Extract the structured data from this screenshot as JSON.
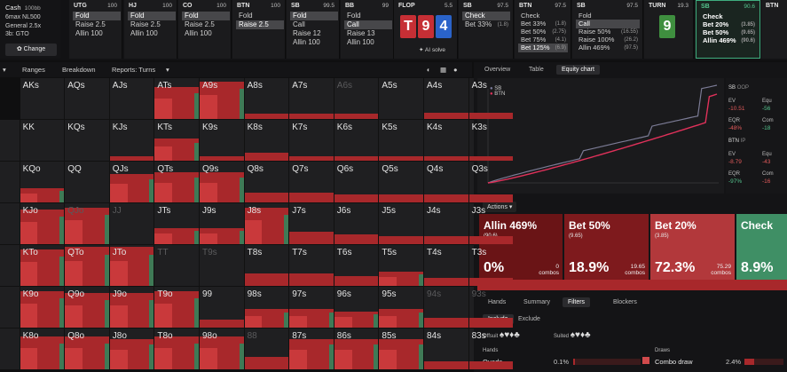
{
  "game": {
    "mode": "Cash",
    "stakes": "100bb",
    "lines": [
      "6max NL500",
      "General 2.5x",
      "3b: GTO"
    ],
    "change_label": "Change"
  },
  "positions": [
    {
      "name": "UTG",
      "stack": "100",
      "actions": [
        {
          "label": "Fold",
          "sel": true
        },
        {
          "label": "Raise 2.5",
          "sel": false
        },
        {
          "label": "Allin 100",
          "sel": false
        }
      ]
    },
    {
      "name": "HJ",
      "stack": "100",
      "actions": [
        {
          "label": "Fold",
          "sel": true
        },
        {
          "label": "Raise 2.5",
          "sel": false
        },
        {
          "label": "Allin 100",
          "sel": false
        }
      ]
    },
    {
      "name": "CO",
      "stack": "100",
      "actions": [
        {
          "label": "Fold",
          "sel": true
        },
        {
          "label": "Raise 2.5",
          "sel": false
        },
        {
          "label": "Allin 100",
          "sel": false
        }
      ]
    },
    {
      "name": "BTN",
      "stack": "100",
      "actions": [
        {
          "label": "Fold",
          "sel": false
        },
        {
          "label": "Raise 2.5",
          "sel": true
        }
      ]
    },
    {
      "name": "SB",
      "stack": "99.5",
      "actions": [
        {
          "label": "Fold",
          "sel": true
        },
        {
          "label": "Call",
          "sel": false
        },
        {
          "label": "Raise 12",
          "sel": false
        },
        {
          "label": "Allin 100",
          "sel": false
        }
      ]
    },
    {
      "name": "BB",
      "stack": "99",
      "actions": [
        {
          "label": "Fold",
          "sel": false
        },
        {
          "label": "Call",
          "sel": true
        },
        {
          "label": "Raise 13",
          "sel": false
        },
        {
          "label": "Allin 100",
          "sel": false
        }
      ]
    }
  ],
  "flop": {
    "label": "FLOP",
    "pot": "5.5",
    "cards": [
      {
        "rank": "T",
        "color": "#c62f35"
      },
      {
        "rank": "9",
        "color": "#c62f35"
      },
      {
        "rank": "4",
        "color": "#2a63c9"
      }
    ],
    "ai_label": "AI solve"
  },
  "sb_flop": {
    "name": "SB",
    "stack": "97.5",
    "actions": [
      {
        "label": "Check",
        "sel": true,
        "pct": ""
      },
      {
        "label": "Bet 33%",
        "sel": false,
        "pct": "(1.8)"
      }
    ]
  },
  "btn_flop": {
    "name": "BTN",
    "stack": "97.5",
    "actions": [
      {
        "label": "Check",
        "sel": false,
        "pct": ""
      },
      {
        "label": "Bet 33%",
        "sel": false,
        "pct": "(1.8)"
      },
      {
        "label": "Bet 50%",
        "sel": false,
        "pct": "(2.75)"
      },
      {
        "label": "Bet 75%",
        "sel": false,
        "pct": "(4.1)"
      },
      {
        "label": "Bet 125%",
        "sel": true,
        "pct": "(6.9)"
      }
    ]
  },
  "sb_flop2": {
    "name": "SB",
    "stack": "97.5",
    "actions": [
      {
        "label": "Fold",
        "sel": false,
        "pct": ""
      },
      {
        "label": "Call",
        "sel": true,
        "pct": ""
      },
      {
        "label": "Raise 50%",
        "sel": false,
        "pct": "(16.55)"
      },
      {
        "label": "Raise 100%",
        "sel": false,
        "pct": "(26.2)"
      },
      {
        "label": "Allin 469%",
        "sel": false,
        "pct": "(97.5)"
      }
    ]
  },
  "turn": {
    "label": "TURN",
    "pot": "19.3",
    "card": "9",
    "card_color": "#3f8f3f"
  },
  "sb_turn": {
    "name": "SB",
    "stack": "90.6",
    "actions": [
      {
        "label": "Check",
        "pct": ""
      },
      {
        "label": "Bet 20%",
        "pct": "(3.85)"
      },
      {
        "label": "Bet 50%",
        "pct": "(9.65)"
      },
      {
        "label": "Allin 469%",
        "pct": "(90.6)"
      }
    ]
  },
  "btn_turn": {
    "name": "BTN"
  },
  "toolbar": {
    "ranges": "Ranges",
    "breakdown": "Breakdown",
    "reports": "Reports: Turns"
  },
  "grid": [
    [
      "AKs",
      "AQs",
      "AJs",
      "ATs",
      "A9s",
      "A8s",
      "A7s",
      "A6s",
      "A5s",
      "A4s",
      "A3s",
      "A2s"
    ],
    [
      "",
      "KK",
      "KQs",
      "KJs",
      "KTs",
      "K9s",
      "K8s",
      "K7s",
      "K6s",
      "K5s",
      "K4s",
      "K3s",
      "K2s"
    ],
    [
      "",
      "KQo",
      "QQ",
      "QJs",
      "QTs",
      "Q9s",
      "Q8s",
      "Q7s",
      "Q6s",
      "Q5s",
      "Q4s",
      "Q3s",
      "Q2s"
    ],
    [
      "",
      "KJo",
      "QJo",
      "JJ",
      "JTs",
      "J9s",
      "J8s",
      "J7s",
      "J6s",
      "J5s",
      "J4s",
      "J3s",
      "J2s"
    ],
    [
      "",
      "KTo",
      "QTo",
      "JTo",
      "TT",
      "T9s",
      "T8s",
      "T7s",
      "T6s",
      "T5s",
      "T4s",
      "T3s",
      "T2s"
    ],
    [
      "",
      "K9o",
      "Q9o",
      "J9o",
      "T9o",
      "99",
      "98s",
      "97s",
      "96s",
      "95s",
      "94s",
      "93s",
      "92s"
    ],
    [
      "",
      "K8o",
      "Q8o",
      "J8o",
      "T8o",
      "98o",
      "88",
      "87s",
      "86s",
      "85s",
      "84s",
      "83s",
      "82s"
    ]
  ],
  "panel": {
    "tabs": [
      "Overview",
      "Table",
      "Equity chart"
    ],
    "legend": [
      {
        "name": "SB",
        "color": "#7a7a9a"
      },
      {
        "name": "BTN",
        "color": "#e0315a"
      }
    ],
    "stats": {
      "sb_block": {
        "title": "SB",
        "sub": "OOP",
        "ev_label": "EV",
        "ev": "-10.51",
        "eqr_label": "EQR",
        "eqr": "-48%",
        "equity_label": "Equ",
        "equity": "-56",
        "combos_label": "Com",
        "combos": "-18"
      },
      "btn_block": {
        "title": "BTN",
        "sub": "IP",
        "ev_label": "EV",
        "ev": "-8.79",
        "eqr_label": "EQR",
        "eqr": "-97%",
        "equity_label": "Equ",
        "equity": "-43",
        "combos_label": "Com",
        "combos": "-16"
      }
    },
    "actions_label": "Actions",
    "action_cards": [
      {
        "title": "Allin 469%",
        "sub": "(90.6)",
        "freq": "0%",
        "combos": "0",
        "combos_label": "combos",
        "color": "#6a1416"
      },
      {
        "title": "Bet 50%",
        "sub": "(9.65)",
        "freq": "18.9%",
        "combos": "19.65",
        "combos_label": "combos",
        "color": "#7e1a1d"
      },
      {
        "title": "Bet 20%",
        "sub": "(3.85)",
        "freq": "72.3%",
        "combos": "75.29",
        "combos_label": "combos",
        "color": "#b2383b"
      },
      {
        "title": "Check",
        "sub": "",
        "freq": "8.9%",
        "combos": "",
        "combos_label": "",
        "color": "#3f8f65"
      }
    ],
    "bottom_tabs": [
      "Hands",
      "Summary",
      "Filters",
      "Blockers"
    ],
    "filter_tabs": [
      "Include",
      "Exclude"
    ],
    "offsuit_label": "Offsuit",
    "suited_label": "Suited",
    "hands_label": "Hands",
    "draws_label": "Draws",
    "rows": [
      {
        "left": "Quads",
        "left_pct": "0.1%",
        "right": "Combo draw",
        "right_pct": "2.4%"
      }
    ]
  }
}
